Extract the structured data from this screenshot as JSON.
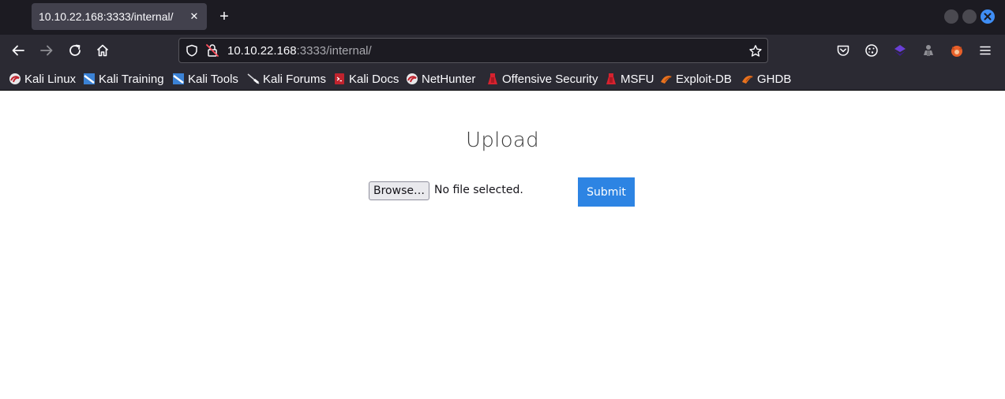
{
  "browser": {
    "tab": {
      "title": "10.10.22.168:3333/internal/",
      "close_glyph": "✕"
    },
    "new_tab_glyph": "+",
    "url": {
      "host": "10.10.22.168",
      "rest": ":3333/internal/"
    },
    "accent_color": "#3f8ef5",
    "bookmarks": [
      {
        "label": "Kali Linux",
        "icon": "kali-dragon-icon"
      },
      {
        "label": "Kali Training",
        "icon": "kali-training-icon"
      },
      {
        "label": "Kali Tools",
        "icon": "kali-tools-icon"
      },
      {
        "label": "Kali Forums",
        "icon": "kali-forums-icon"
      },
      {
        "label": "Kali Docs",
        "icon": "kali-docs-icon"
      },
      {
        "label": "NetHunter",
        "icon": "nethunter-icon"
      },
      {
        "label": "Offensive Security",
        "icon": "offsec-icon"
      },
      {
        "label": "MSFU",
        "icon": "msfu-icon"
      },
      {
        "label": "Exploit-DB",
        "icon": "exploit-db-icon"
      },
      {
        "label": "GHDB",
        "icon": "ghdb-icon"
      }
    ]
  },
  "page": {
    "title": "Upload",
    "browse_label": "Browse…",
    "file_status": "No file selected.",
    "submit_label": "Submit",
    "submit_color": "#2d84e3"
  }
}
